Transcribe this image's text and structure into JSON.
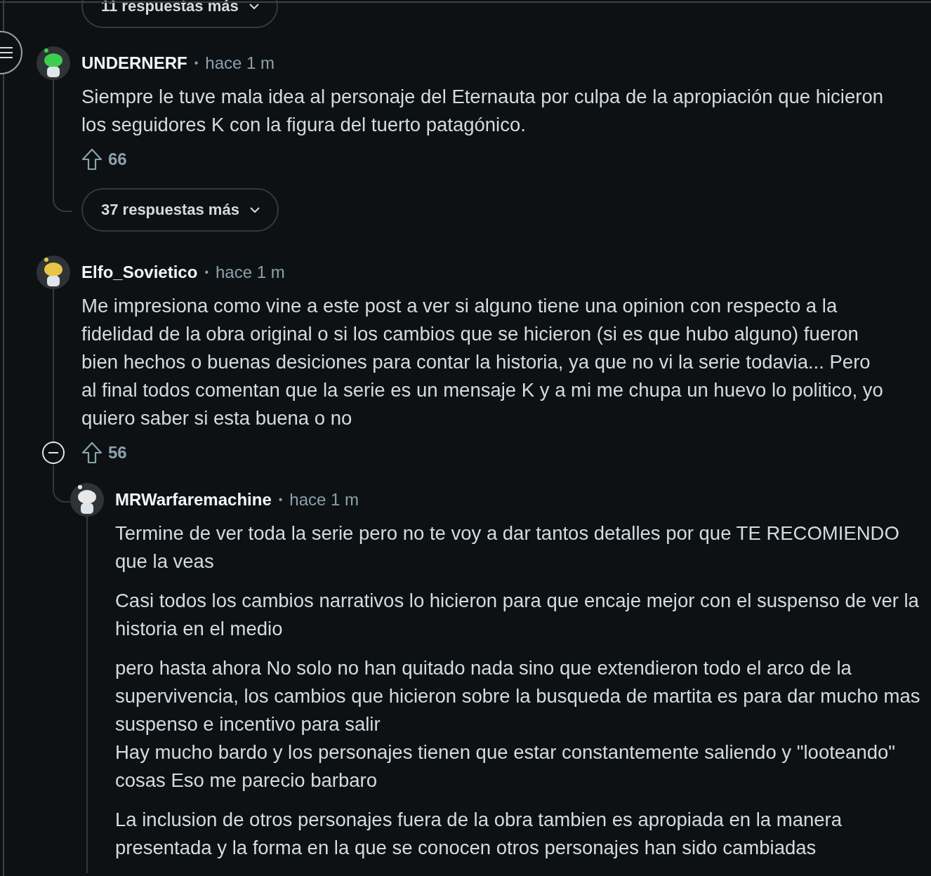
{
  "top_more_replies": {
    "label": "11 respuestas más"
  },
  "comments": [
    {
      "author": "UNDERNERF",
      "dot": "•",
      "time": "hace 1 m",
      "paragraphs": [
        "Siempre le tuve mala idea al personaje del Eternauta por culpa de la apropiación que hicieron los seguidores K con la figura del tuerto patagónico."
      ],
      "votes": "66",
      "collapsible": false,
      "more_replies": "37 respuestas más"
    },
    {
      "author": "Elfo_Sovietico",
      "dot": "•",
      "time": "hace 1 m",
      "paragraphs": [
        "Me impresiona como vine a este post a ver si alguno tiene una opinion con respecto a la fidelidad de la obra original o si los cambios que se hicieron (si es que hubo alguno) fueron bien hechos o buenas desiciones para contar la historia, ya que no vi la serie todavia... Pero al final todos comentan que la serie es un mensaje K y a mi me chupa un huevo lo politico, yo quiero saber si esta buena o no"
      ],
      "votes": "56",
      "collapsible": true,
      "replies": [
        {
          "author": "MRWarfaremachine",
          "dot": "•",
          "time": "hace 1 m",
          "paragraphs": [
            "Termine de ver toda la serie pero no te voy a dar tantos detalles por que TE RECOMIENDO que la veas",
            "Casi todos los cambios narrativos lo hicieron para que encaje mejor con el suspenso de ver la historia en el medio",
            "pero hasta ahora No solo no han quitado nada sino que extendieron todo el arco de la supervivencia, los cambios que hicieron sobre la busqueda de martita es para dar mucho mas suspenso e incentivo para salir\nHay mucho bardo y los personajes tienen que estar constantemente saliendo y \"looteando\" cosas Eso me parecio barbaro",
            "La inclusion de otros personajes fuera de la obra tambien es apropiada en la manera presentada y la forma en la que se conocen otros personajes han sido cambiadas"
          ]
        }
      ]
    }
  ]
}
